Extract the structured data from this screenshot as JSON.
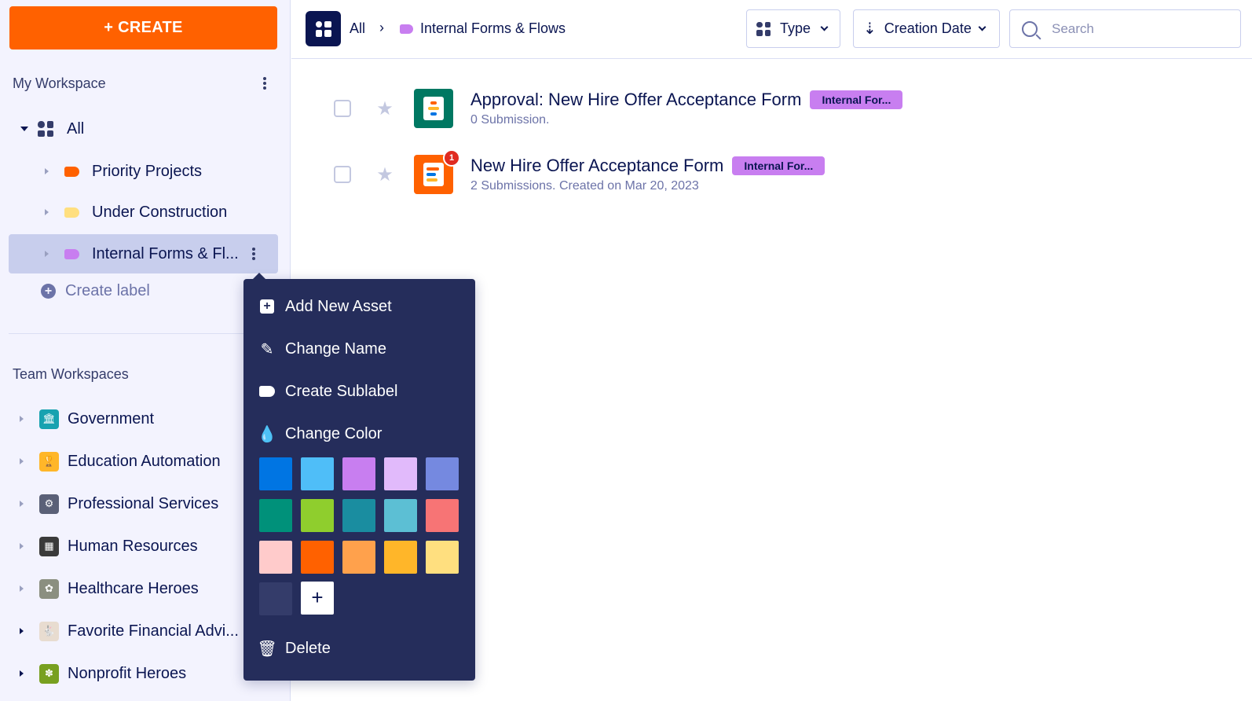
{
  "sidebar": {
    "create_label": "+ CREATE",
    "my_workspace_title": "My Workspace",
    "tree": {
      "all_label": "All",
      "items": [
        {
          "label": "Priority Projects",
          "color": "#ff6100"
        },
        {
          "label": "Under Construction",
          "color": "#ffdf7f"
        },
        {
          "label": "Internal Forms & Fl...",
          "color": "#c87ef0"
        }
      ],
      "create_label": "Create label"
    },
    "team_workspaces_title": "Team Workspaces",
    "teams": [
      {
        "label": "Government",
        "color": "#18a2b0",
        "glyph": "🏛"
      },
      {
        "label": "Education Automation",
        "color": "#ffb629",
        "glyph": "🏆"
      },
      {
        "label": "Professional Services",
        "color": "#5a6077",
        "glyph": "⚙"
      },
      {
        "label": "Human Resources",
        "color": "#3a3a3a",
        "glyph": "▦"
      },
      {
        "label": "Healthcare Heroes",
        "color": "#8b8f80",
        "glyph": "✿"
      },
      {
        "label": "Favorite Financial Advi...",
        "color": "#f3f3fe",
        "glyph": "🐇"
      },
      {
        "label": "Nonprofit Heroes",
        "color": "#78a020",
        "glyph": "✽"
      }
    ]
  },
  "topbar": {
    "breadcrumb_all": "All",
    "breadcrumb_sep": "›",
    "breadcrumb_current": "Internal Forms & Flows",
    "type_label": "Type",
    "sort_label": "Creation Date",
    "search_placeholder": "Search"
  },
  "forms": [
    {
      "title": "Approval: New Hire Offer Acceptance Form",
      "badge": "Internal For...",
      "subtitle": "0 Submission.",
      "icon_color": "#007862",
      "notification": null
    },
    {
      "title": "New Hire Offer Acceptance Form",
      "badge": "Internal For...",
      "subtitle": "2 Submissions. Created on Mar 20, 2023",
      "icon_color": "#ff6100",
      "notification": "1"
    }
  ],
  "context_menu": {
    "add_new_asset": "Add New Asset",
    "change_name": "Change Name",
    "create_sublabel": "Create Sublabel",
    "change_color": "Change Color",
    "delete": "Delete",
    "add_color_label": "+",
    "colors": [
      "#0075e3",
      "#4fbef8",
      "#c87ef0",
      "#e1bafb",
      "#7589e0",
      "#00917a",
      "#8fce2d",
      "#1a8da0",
      "#5cbfd4",
      "#f77475",
      "#ffcbcb",
      "#ff6100",
      "#ffa14c",
      "#ffb629",
      "#ffdf7f",
      "#343c6a"
    ]
  }
}
